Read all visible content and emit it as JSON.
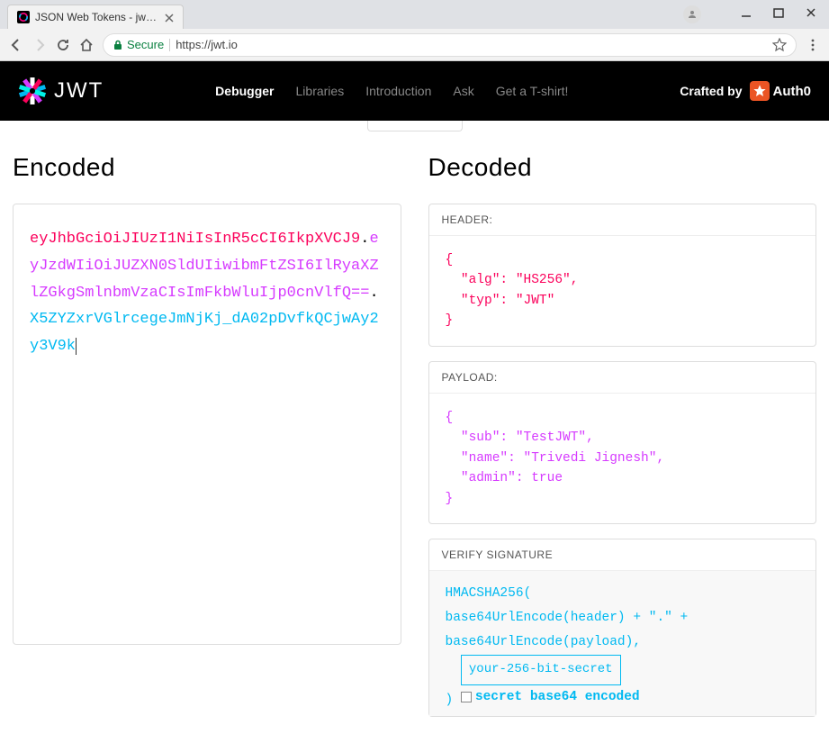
{
  "browser": {
    "tab_title": "JSON Web Tokens - jwt.io",
    "secure_label": "Secure",
    "url": "https://jwt.io"
  },
  "nav": {
    "items": [
      "Debugger",
      "Libraries",
      "Introduction",
      "Ask",
      "Get a T-shirt!"
    ],
    "active_index": 0,
    "crafted_by_label": "Crafted by",
    "auth0_label": "Auth0"
  },
  "sections": {
    "encoded_title": "Encoded",
    "decoded_title": "Decoded"
  },
  "jwt": {
    "header": "eyJhbGciOiJIUzI1NiIsInR5cCI6IkpXVCJ9",
    "payload": "eyJzdWIiOiJUZXN0SldUIiwibmFtZSI6IlRyaXZlZGkgSmlnbmVzaCIsImFkbWluIjp0cnVlfQ==",
    "signature": "X5ZYZxrVGlrcegeJmNjKj_dA02pDvfkQCjwAy2y3V9k"
  },
  "decoded": {
    "header_label": "HEADER:",
    "header_body": "{\n  \"alg\": \"HS256\",\n  \"typ\": \"JWT\"\n}",
    "payload_label": "PAYLOAD:",
    "payload_body": "{\n  \"sub\": \"TestJWT\",\n  \"name\": \"Trivedi Jignesh\",\n  \"admin\": true\n}",
    "signature_label": "VERIFY SIGNATURE",
    "sig_line1": "HMACSHA256(",
    "sig_line2": "  base64UrlEncode(header) + \".\" +",
    "sig_line3": "  base64UrlEncode(payload),",
    "sig_secret": "your-256-bit-secret",
    "sig_paren": ") ",
    "secret_checkbox_label": "secret base64 encoded"
  }
}
